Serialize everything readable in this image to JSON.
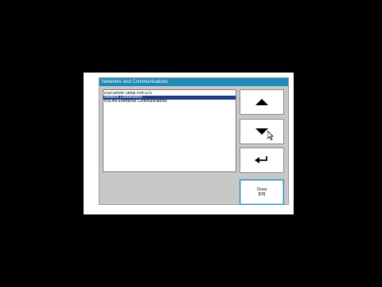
{
  "window": {
    "title": "Networks and Communications"
  },
  "list": {
    "items": [
      {
        "label": "RSPServer Serial Port ID's",
        "selected": false
      },
      {
        "label": "Network Connections",
        "selected": true
      },
      {
        "label": "RSLinx Enterprise Communications",
        "selected": false
      }
    ]
  },
  "buttons": {
    "up": {
      "icon": "arrow-up-icon"
    },
    "down": {
      "icon": "arrow-down-icon"
    },
    "enter": {
      "icon": "enter-return-icon"
    },
    "close": {
      "line1": "Close",
      "line2": "[F8]"
    }
  },
  "colors": {
    "titlebar": "#1d8ab7",
    "selection": "#1e3e84",
    "dialog_bg": "#c8c8c8"
  }
}
